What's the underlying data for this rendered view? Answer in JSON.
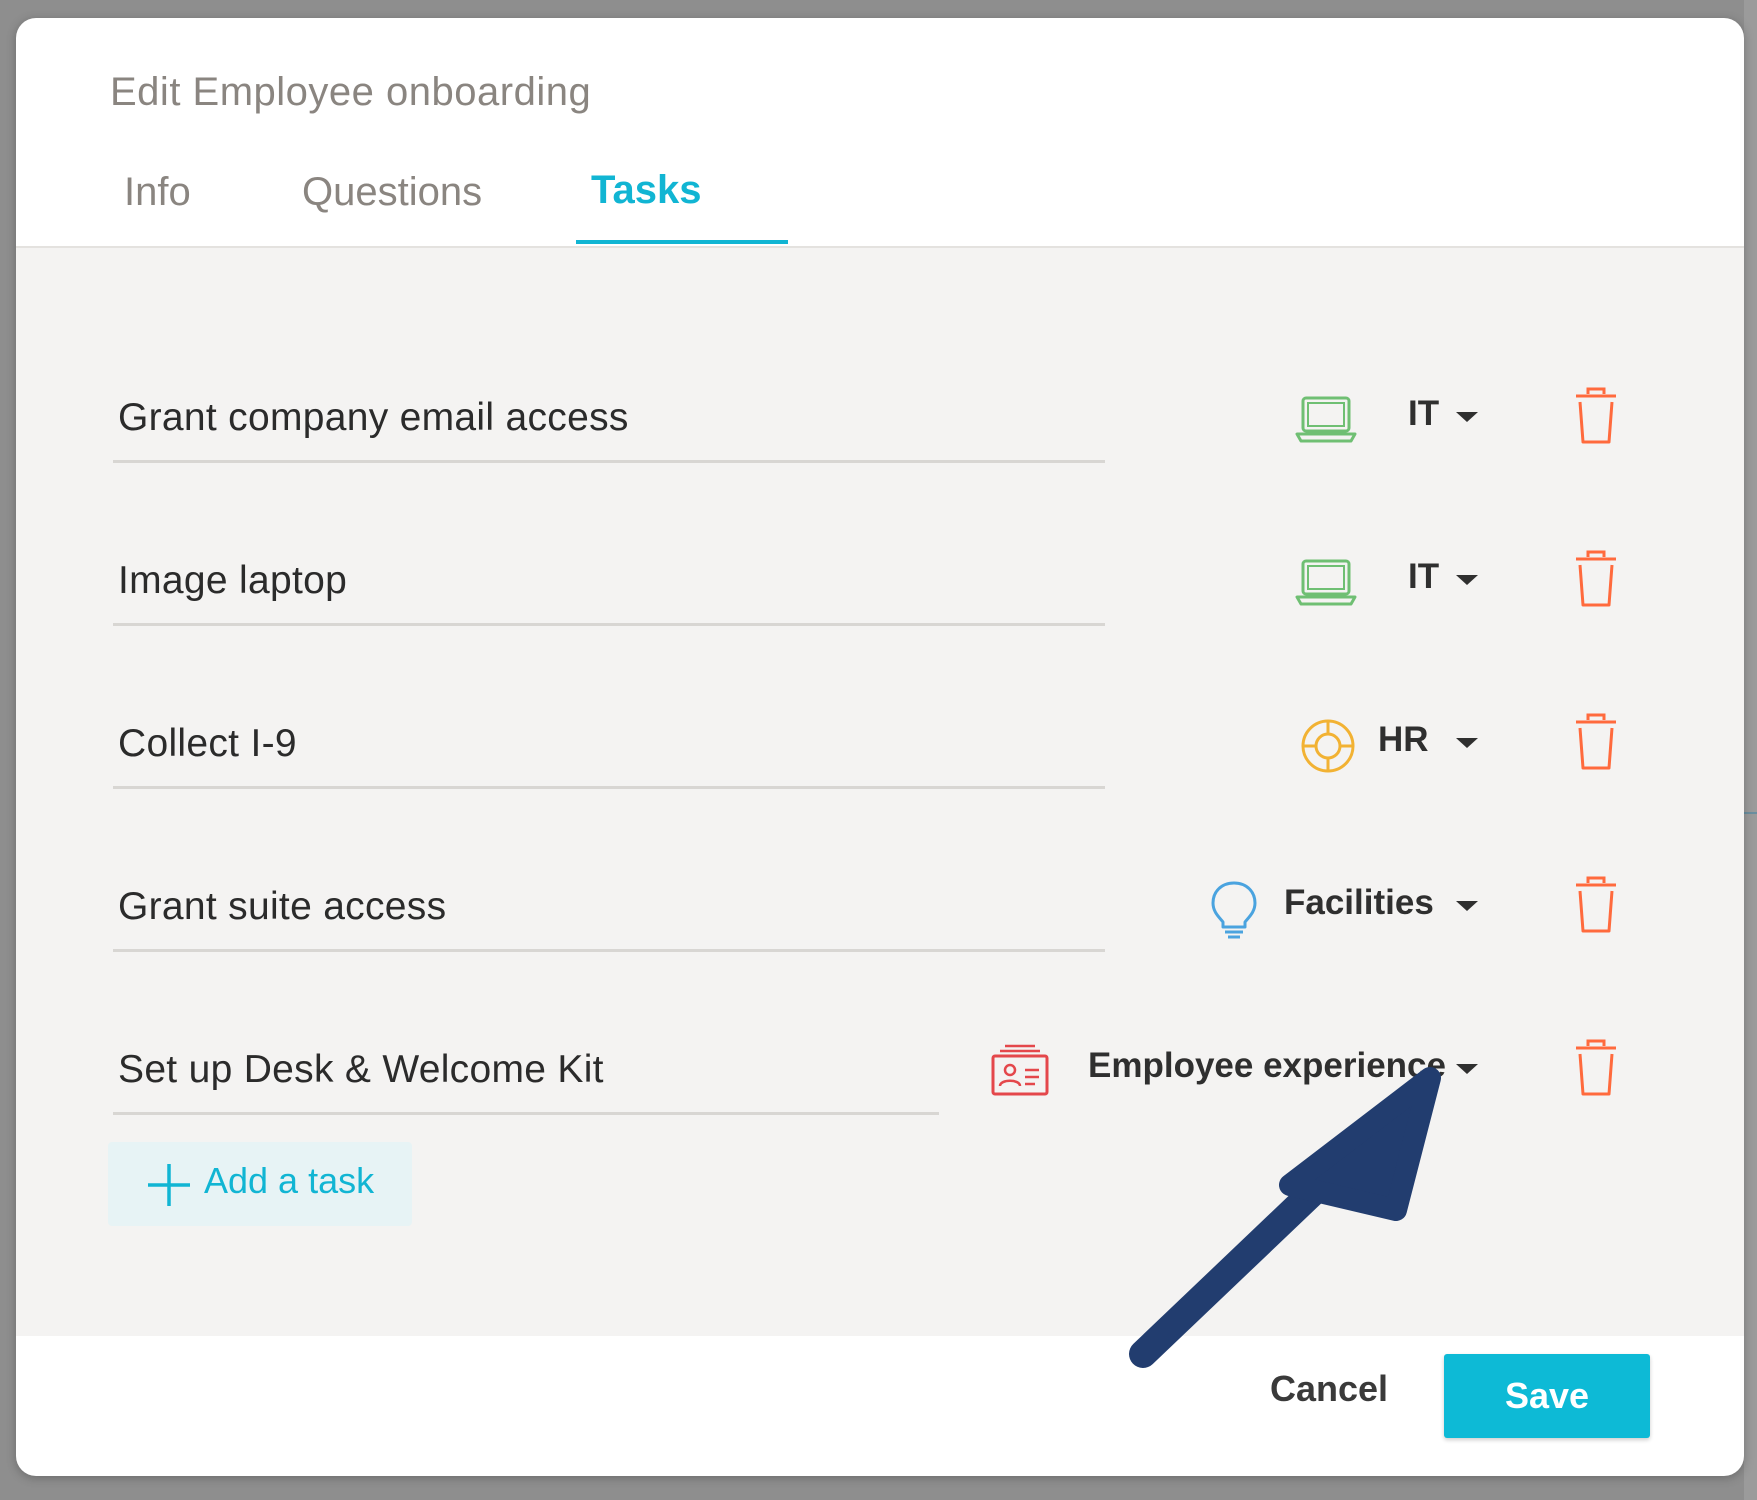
{
  "modal": {
    "title": "Edit Employee onboarding"
  },
  "tabs": [
    {
      "label": "Info",
      "active": false
    },
    {
      "label": "Questions",
      "active": false
    },
    {
      "label": "Tasks",
      "active": true
    }
  ],
  "tasks": [
    {
      "name": "Grant company email access",
      "category": "IT",
      "icon": "laptop-icon",
      "icon_color": "#6fbf73"
    },
    {
      "name": "Image laptop",
      "category": "IT",
      "icon": "laptop-icon",
      "icon_color": "#6fbf73"
    },
    {
      "name": "Collect I-9",
      "category": "HR",
      "icon": "lifebuoy-icon",
      "icon_color": "#f2b233"
    },
    {
      "name": "Grant suite access",
      "category": "Facilities",
      "icon": "lightbulb-icon",
      "icon_color": "#4aa3df"
    },
    {
      "name": "Set up Desk & Welcome Kit",
      "category": "Employee experience",
      "icon": "id-card-icon",
      "icon_color": "#e4474b"
    }
  ],
  "add_task": {
    "label": "Add a task"
  },
  "footer": {
    "cancel_label": "Cancel",
    "save_label": "Save"
  },
  "colors": {
    "accent": "#11b5d3",
    "delete": "#ff6a3d",
    "annotation_arrow": "#223d6f"
  }
}
